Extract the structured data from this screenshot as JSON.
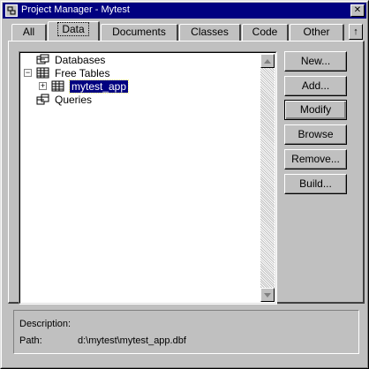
{
  "window": {
    "title": "Project Manager - Mytest",
    "close_glyph": "✕"
  },
  "tabs": [
    {
      "label": "All"
    },
    {
      "label": "Data",
      "active": true
    },
    {
      "label": "Documents"
    },
    {
      "label": "Classes"
    },
    {
      "label": "Code"
    },
    {
      "label": "Other"
    }
  ],
  "tab_scroll_glyph": "↑",
  "tree": {
    "items": [
      {
        "label": "Databases",
        "icon": "database-icon"
      },
      {
        "label": "Free Tables",
        "icon": "table-icon",
        "expander": "−"
      },
      {
        "label": "mytest_app",
        "icon": "table-icon",
        "expander": "+",
        "selected": true
      },
      {
        "label": "Queries",
        "icon": "query-icon"
      }
    ]
  },
  "buttons": {
    "new": "New...",
    "add": "Add...",
    "modify": "Modify",
    "browse": "Browse",
    "remove": "Remove...",
    "build": "Build..."
  },
  "details": {
    "description_label": "Description:",
    "description_value": "",
    "path_label": "Path:",
    "path_value": "d:\\mytest\\mytest_app.dbf"
  },
  "colors": {
    "title_bar": "#000080",
    "face": "#c0c0c0",
    "selection": "#000080"
  }
}
